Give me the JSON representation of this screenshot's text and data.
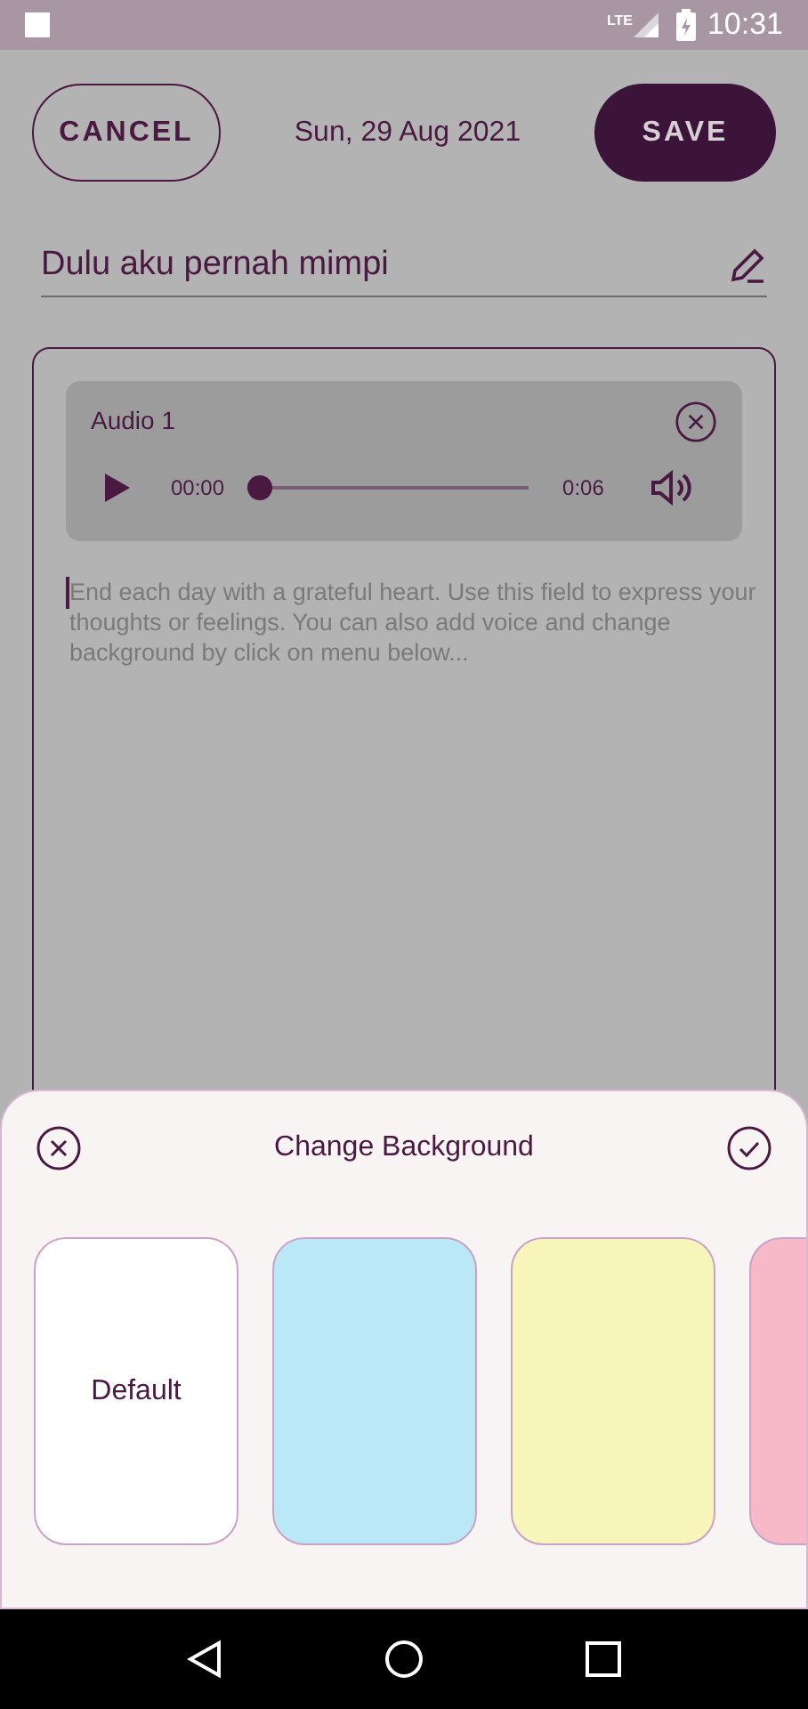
{
  "status_bar": {
    "network": "LTE",
    "time": "10:31"
  },
  "header": {
    "cancel": "CANCEL",
    "date": "Sun, 29 Aug 2021",
    "save": "SAVE"
  },
  "title_field": {
    "value": "Dulu aku pernah mimpi"
  },
  "audio": {
    "name": "Audio 1",
    "elapsed": "00:00",
    "duration": "0:06",
    "level": 0
  },
  "body_field": {
    "placeholder": "End each day with a grateful heart. Use this field to express your thoughts or feelings. You can also add voice and change background by click on menu below..."
  },
  "sheet": {
    "title": "Change Background",
    "swatches": [
      {
        "label": "Default",
        "color": "#ffffff"
      },
      {
        "color": "#bbe8f6"
      },
      {
        "color": "#f8f5bb"
      },
      {
        "color": "#f7b9c8"
      }
    ]
  }
}
